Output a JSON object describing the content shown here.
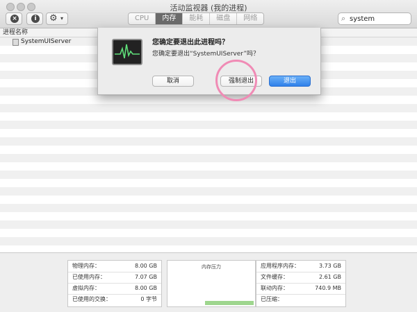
{
  "window": {
    "title": "活动监视器 (我的进程)"
  },
  "toolbar": {
    "close_glyph": "×",
    "info_glyph": "i",
    "gear_glyph": "⚙",
    "caret_glyph": "▾",
    "tabs": [
      {
        "label": "CPU",
        "active": false
      },
      {
        "label": "内存",
        "active": true
      },
      {
        "label": "能耗",
        "active": false
      },
      {
        "label": "磁盘",
        "active": false
      },
      {
        "label": "网络",
        "active": false
      }
    ],
    "search_value": "system",
    "search_glyph": "⌕"
  },
  "table": {
    "column_header": "进程名称",
    "rows": [
      {
        "name": "SystemUIServer"
      }
    ]
  },
  "dialog": {
    "title": "您确定要退出此进程吗？",
    "message": "您确定要退出“SystemUIServer”吗？",
    "cancel_label": "取消",
    "force_quit_label": "强制退出",
    "quit_label": "退出"
  },
  "memory": {
    "left": [
      {
        "label": "物理内存：",
        "value": "8.00 GB"
      },
      {
        "label": "已使用内存：",
        "value": "7.07 GB"
      },
      {
        "label": "虚拟内存：",
        "value": "8.00 GB"
      },
      {
        "label": "已使用的交换：",
        "value": "0 字节"
      }
    ],
    "pressure_label": "内存压力",
    "right": [
      {
        "label": "应用程序内存：",
        "value": "3.73 GB"
      },
      {
        "label": "文件缓存：",
        "value": "2.61 GB"
      },
      {
        "label": "联动内存：",
        "value": "740.9 MB"
      },
      {
        "label": "已压缩：",
        "value": ""
      }
    ]
  },
  "colors": {
    "accent": "#2f80ea",
    "pressure_green": "#9ed68e",
    "highlight_pink": "#f08bb5"
  }
}
